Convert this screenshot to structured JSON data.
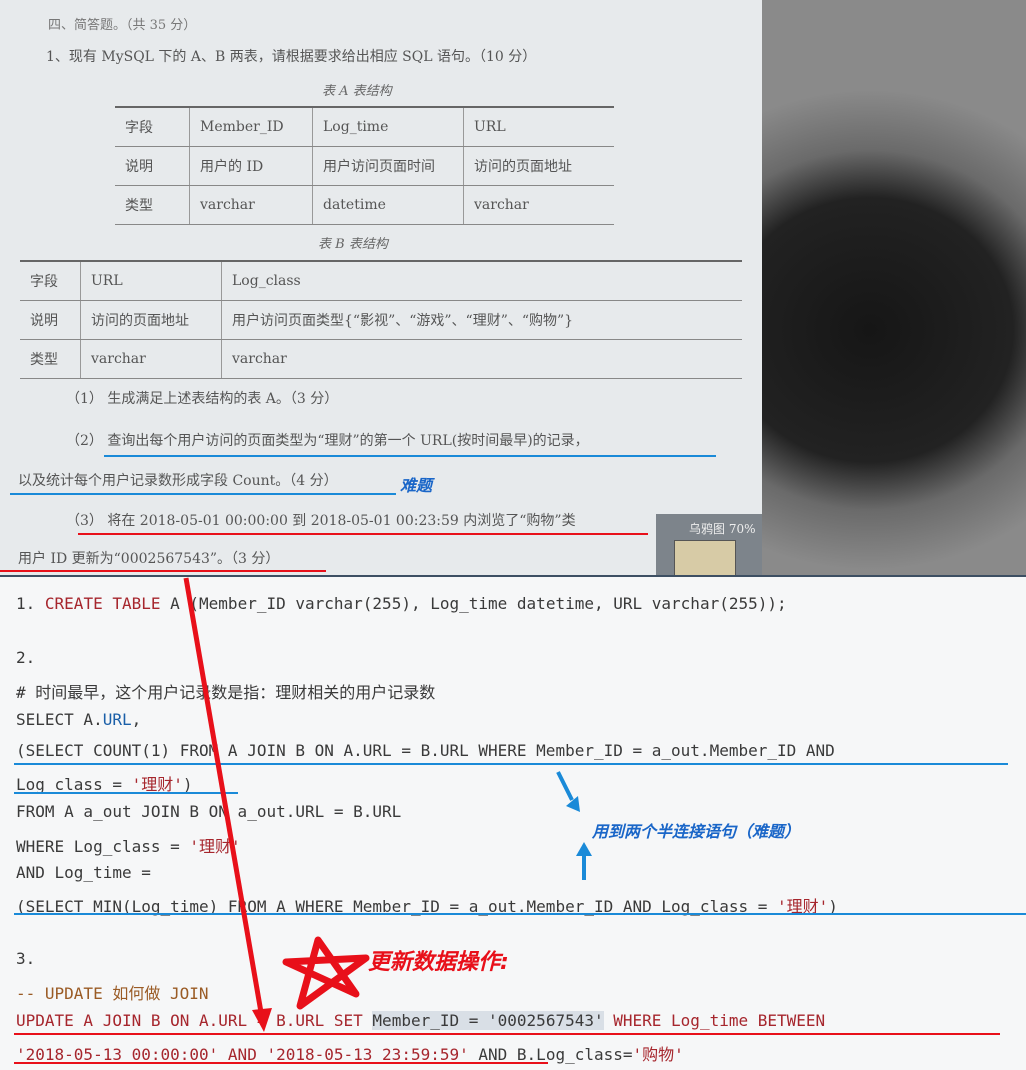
{
  "exam": {
    "section_title": "四、简答题。（共 35 分）",
    "question1": "1、现有 MySQL 下的 A、B 两表，请根据要求给出相应 SQL 语句。（10 分）",
    "table_a_caption": "表 A 表结构",
    "table_a_rows": [
      [
        "字段",
        "Member_ID",
        "Log_time",
        "URL"
      ],
      [
        "说明",
        "用户的 ID",
        "用户访问页面时间",
        "访问的页面地址"
      ],
      [
        "类型",
        "varchar",
        "datetime",
        "varchar"
      ]
    ],
    "table_b_caption": "表 B 表结构",
    "table_b_rows": [
      [
        "字段",
        "URL",
        "Log_class"
      ],
      [
        "说明",
        "访问的页面地址",
        "用户访问页面类型{“影视”、“游戏”、“理财”、“购物”}"
      ],
      [
        "类型",
        "varchar",
        "varchar"
      ]
    ],
    "sub1": "（1）  生成满足上述表结构的表 A。（3 分）",
    "sub2": "（2）  查询出每个用户访问的页面类型为“理财”的第一个 URL(按时间最早)的记录，",
    "sub2_cont": "以及统计每个用户记录数形成字段 Count。（4 分）",
    "hard_label": "难题",
    "sub3": "（3）  将在 2018-05-01 00:00:00 到 2018-05-01 00:23:59 内浏览了“购物”类",
    "sub3_cont": "用户 ID 更新为“0002567543”。（3 分）",
    "zoom_label": "乌鸦图 70%"
  },
  "code": {
    "line1_prefix": "1. ",
    "line1_kw": "CREATE TABLE",
    "line1_rest": " A (Member_ID varchar(255), Log_time datetime, URL varchar(255));",
    "l2": "2.",
    "l3": "# 时间最早，这个用户记录数是指：理财相关的用户记录数",
    "l4a": "SELECT A.",
    "l4b": "URL",
    "l4c": ",",
    "l5": "(SELECT COUNT(1) FROM A JOIN B ON A.URL = B.URL WHERE Member_ID = a_out.Member_ID AND",
    "l6a": "Log_class = ",
    "l6b": "'理财'",
    "l6c": ")",
    "l7": "FROM A a_out JOIN B ON a_out.URL = B.URL",
    "l8a": "WHERE Log_class = ",
    "l8b": "'理财'",
    "l9": "AND Log_time =",
    "l10a": "(SELECT MIN(Log_time) FROM A WHERE Member_ID = a_out.Member_ID AND  Log_class = ",
    "l10b": "'理财'",
    "l10c": ")",
    "l11": "3.",
    "l12": "-- UPDATE 如何做 JOIN",
    "l13a": "UPDATE A JOIN B ON A.URL = B.URL SET ",
    "l13b": "Member_ID = '0002567543'",
    "l13c": " WHERE Log_time BETWEEN",
    "l14a": "'2018-05-13 00:00:00' AND '2018-05-13 23:59:59'",
    "l14b": " AND B.Log_class=",
    "l14c": "'购物'",
    "annot_blue": "用到两个半连接语句（难题）",
    "annot_red": "更新数据操作:"
  },
  "colors": {
    "red": "#e8101a",
    "blue": "#1a8ad8",
    "keyword": "#a6262d"
  }
}
